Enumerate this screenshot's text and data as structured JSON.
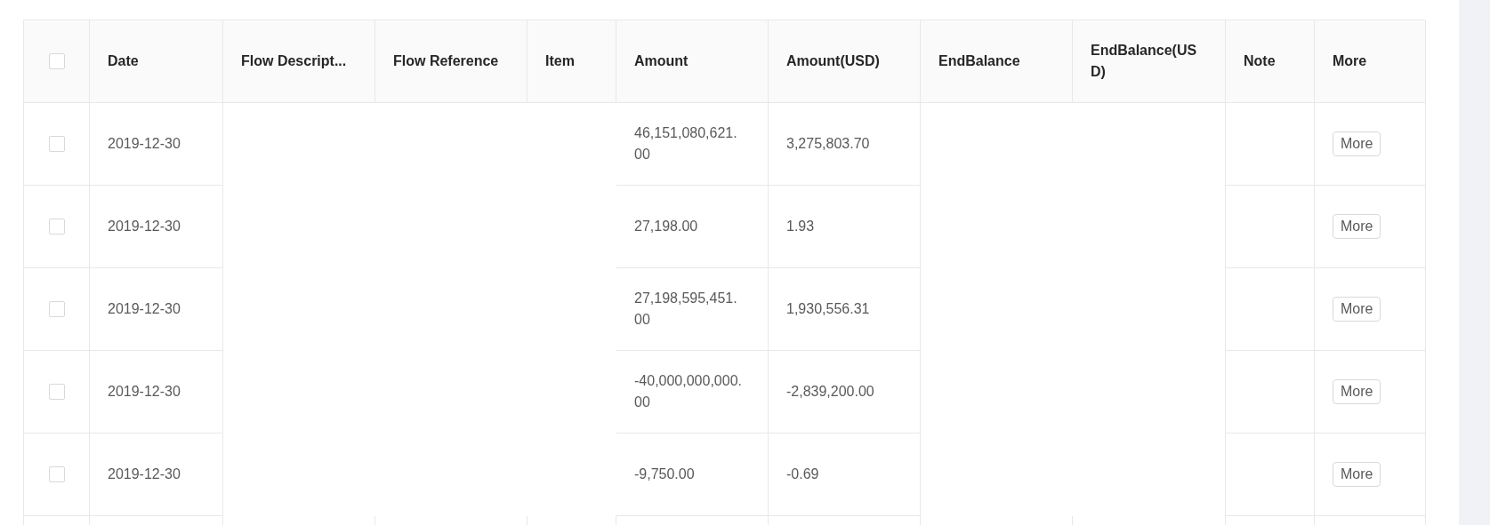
{
  "table": {
    "header_checkbox": {
      "checked": false
    },
    "columns": [
      "Date",
      "Flow Descript...",
      "Flow Reference",
      "Item",
      "Amount",
      "Amount(USD)",
      "EndBalance",
      "EndBalance(USD)",
      "Note",
      "More"
    ],
    "rows": [
      {
        "checked": false,
        "date": "2019-12-30",
        "amount": "46,151,080,621.00",
        "amount_usd": "3,275,803.70",
        "action": "More"
      },
      {
        "checked": false,
        "date": "2019-12-30",
        "amount": "27,198.00",
        "amount_usd": "1.93",
        "action": "More"
      },
      {
        "checked": false,
        "date": "2019-12-30",
        "amount": "27,198,595,451.00",
        "amount_usd": "1,930,556.31",
        "action": "More"
      },
      {
        "checked": false,
        "date": "2019-12-30",
        "amount": "-40,000,000,000.00",
        "amount_usd": "-2,839,200.00",
        "action": "More"
      },
      {
        "checked": false,
        "date": "2019-12-30",
        "amount": "-9,750.00",
        "amount_usd": "-0.69",
        "action": "More"
      }
    ]
  }
}
